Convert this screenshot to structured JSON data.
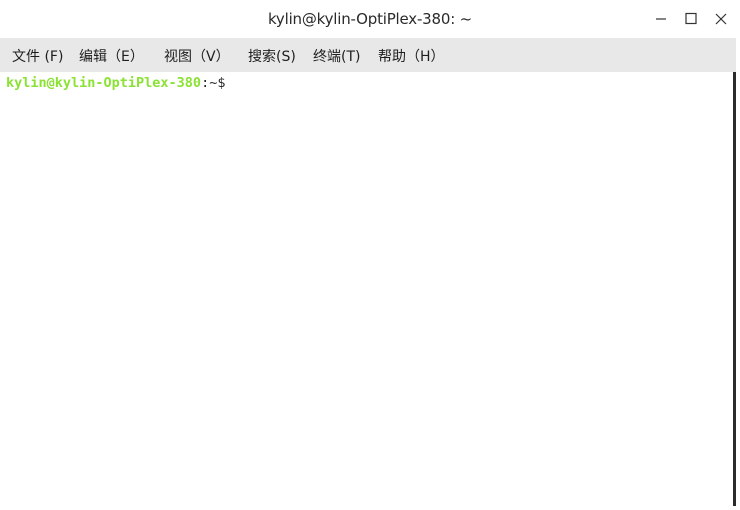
{
  "window": {
    "title": "kylin@kylin-OptiPlex-380: ~",
    "controls": {
      "minimize_icon": "minimize-icon",
      "maximize_icon": "maximize-icon",
      "close_icon": "close-icon"
    }
  },
  "menubar": {
    "items": [
      {
        "label": "文件 (F)"
      },
      {
        "label": "编辑（E）"
      },
      {
        "label": "视图（V）"
      },
      {
        "label": "搜索(S)"
      },
      {
        "label": "终端(T)"
      },
      {
        "label": "帮助（H）"
      }
    ]
  },
  "terminal": {
    "prompt_user_host": "kylin@kylin-OptiPlex-380",
    "prompt_colon": ":",
    "prompt_path": "~",
    "prompt_symbol": "$",
    "colors": {
      "user_host": "#8ae234",
      "path": "#729fcf",
      "background": "#ffffff"
    }
  }
}
